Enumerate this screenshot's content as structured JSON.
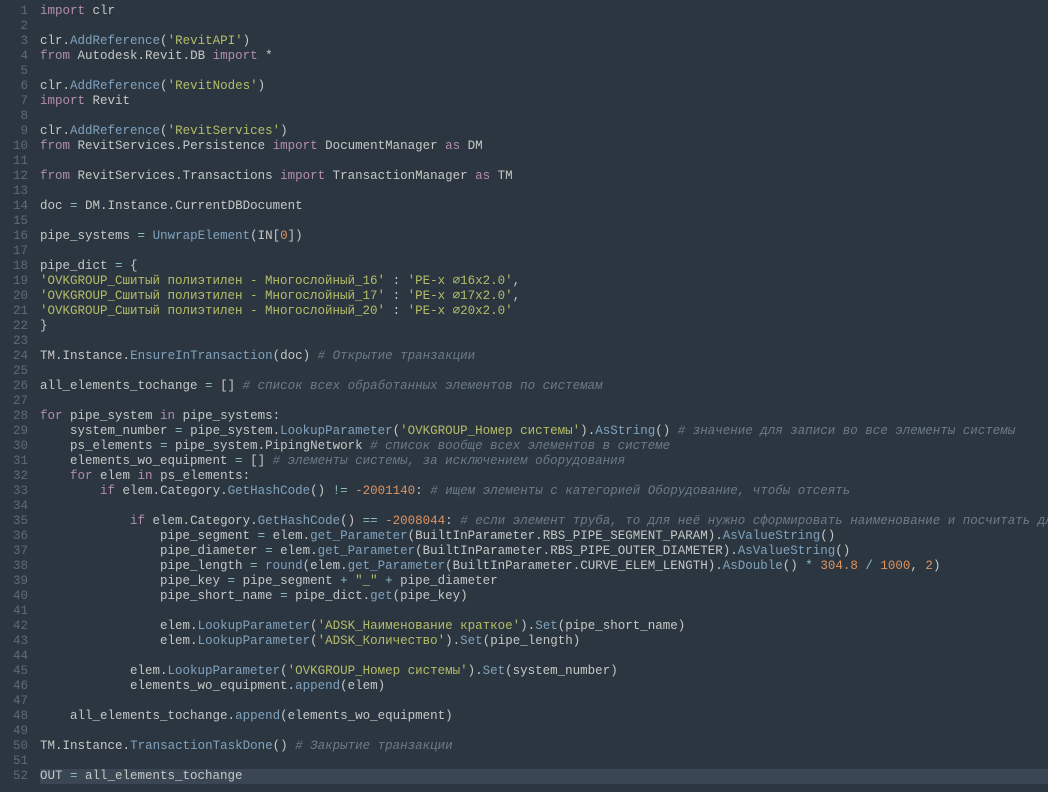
{
  "code_lines": [
    {
      "n": 1,
      "tokens": [
        [
          "kw",
          "import"
        ],
        [
          "id",
          " clr"
        ]
      ]
    },
    {
      "n": 2,
      "tokens": []
    },
    {
      "n": 3,
      "tokens": [
        [
          "id",
          "clr"
        ],
        [
          "op",
          "."
        ],
        [
          "fn",
          "AddReference"
        ],
        [
          "op",
          "("
        ],
        [
          "str",
          "'RevitAPI'"
        ],
        [
          "op",
          ")"
        ]
      ]
    },
    {
      "n": 4,
      "tokens": [
        [
          "kw",
          "from"
        ],
        [
          "id",
          " Autodesk"
        ],
        [
          "op",
          "."
        ],
        [
          "id",
          "Revit"
        ],
        [
          "op",
          "."
        ],
        [
          "id",
          "DB "
        ],
        [
          "kw",
          "import"
        ],
        [
          "id",
          " "
        ],
        [
          "op",
          "*"
        ]
      ]
    },
    {
      "n": 5,
      "tokens": []
    },
    {
      "n": 6,
      "tokens": [
        [
          "id",
          "clr"
        ],
        [
          "op",
          "."
        ],
        [
          "fn",
          "AddReference"
        ],
        [
          "op",
          "("
        ],
        [
          "str",
          "'RevitNodes'"
        ],
        [
          "op",
          ")"
        ]
      ]
    },
    {
      "n": 7,
      "tokens": [
        [
          "kw",
          "import"
        ],
        [
          "id",
          " Revit"
        ]
      ]
    },
    {
      "n": 8,
      "tokens": []
    },
    {
      "n": 9,
      "tokens": [
        [
          "id",
          "clr"
        ],
        [
          "op",
          "."
        ],
        [
          "fn",
          "AddReference"
        ],
        [
          "op",
          "("
        ],
        [
          "str",
          "'RevitServices'"
        ],
        [
          "op",
          ")"
        ]
      ]
    },
    {
      "n": 10,
      "tokens": [
        [
          "kw",
          "from"
        ],
        [
          "id",
          " RevitServices"
        ],
        [
          "op",
          "."
        ],
        [
          "id",
          "Persistence "
        ],
        [
          "kw",
          "import"
        ],
        [
          "id",
          " DocumentManager "
        ],
        [
          "kw",
          "as"
        ],
        [
          "id",
          " DM"
        ]
      ]
    },
    {
      "n": 11,
      "tokens": []
    },
    {
      "n": 12,
      "tokens": [
        [
          "kw",
          "from"
        ],
        [
          "id",
          " RevitServices"
        ],
        [
          "op",
          "."
        ],
        [
          "id",
          "Transactions "
        ],
        [
          "kw",
          "import"
        ],
        [
          "id",
          " TransactionManager "
        ],
        [
          "kw",
          "as"
        ],
        [
          "id",
          " TM"
        ]
      ]
    },
    {
      "n": 13,
      "tokens": []
    },
    {
      "n": 14,
      "tokens": [
        [
          "id",
          "doc "
        ],
        [
          "opcol",
          "="
        ],
        [
          "id",
          " DM"
        ],
        [
          "op",
          "."
        ],
        [
          "id",
          "Instance"
        ],
        [
          "op",
          "."
        ],
        [
          "id",
          "CurrentDBDocument"
        ]
      ]
    },
    {
      "n": 15,
      "tokens": []
    },
    {
      "n": 16,
      "tokens": [
        [
          "id",
          "pipe_systems "
        ],
        [
          "opcol",
          "="
        ],
        [
          "id",
          " "
        ],
        [
          "fn",
          "UnwrapElement"
        ],
        [
          "op",
          "(IN["
        ],
        [
          "num",
          "0"
        ],
        [
          "op",
          "])"
        ]
      ]
    },
    {
      "n": 17,
      "tokens": []
    },
    {
      "n": 18,
      "tokens": [
        [
          "id",
          "pipe_dict "
        ],
        [
          "opcol",
          "="
        ],
        [
          "id",
          " "
        ],
        [
          "op",
          "{"
        ]
      ]
    },
    {
      "n": 19,
      "tokens": [
        [
          "str",
          "'OVKGROUP_Сшитый полиэтилен - Многослойный_16'"
        ],
        [
          "id",
          " "
        ],
        [
          "op",
          ":"
        ],
        [
          "id",
          " "
        ],
        [
          "str",
          "'PE-x ⌀16x2.0'"
        ],
        [
          "op",
          ","
        ]
      ]
    },
    {
      "n": 20,
      "tokens": [
        [
          "str",
          "'OVKGROUP_Сшитый полиэтилен - Многослойный_17'"
        ],
        [
          "id",
          " "
        ],
        [
          "op",
          ":"
        ],
        [
          "id",
          " "
        ],
        [
          "str",
          "'PE-x ⌀17x2.0'"
        ],
        [
          "op",
          ","
        ]
      ]
    },
    {
      "n": 21,
      "tokens": [
        [
          "str",
          "'OVKGROUP_Сшитый полиэтилен - Многослойный_20'"
        ],
        [
          "id",
          " "
        ],
        [
          "op",
          ":"
        ],
        [
          "id",
          " "
        ],
        [
          "str",
          "'PE-x ⌀20x2.0'"
        ]
      ]
    },
    {
      "n": 22,
      "tokens": [
        [
          "op",
          "}"
        ]
      ]
    },
    {
      "n": 23,
      "tokens": []
    },
    {
      "n": 24,
      "tokens": [
        [
          "id",
          "TM"
        ],
        [
          "op",
          "."
        ],
        [
          "id",
          "Instance"
        ],
        [
          "op",
          "."
        ],
        [
          "fn",
          "EnsureInTransaction"
        ],
        [
          "op",
          "(doc) "
        ],
        [
          "com",
          "# Открытие транзакции"
        ]
      ]
    },
    {
      "n": 25,
      "tokens": []
    },
    {
      "n": 26,
      "tokens": [
        [
          "id",
          "all_elements_tochange "
        ],
        [
          "opcol",
          "="
        ],
        [
          "id",
          " "
        ],
        [
          "op",
          "[] "
        ],
        [
          "com",
          "# список всех обработанных элементов по системам"
        ]
      ]
    },
    {
      "n": 27,
      "tokens": []
    },
    {
      "n": 28,
      "tokens": [
        [
          "kw",
          "for"
        ],
        [
          "id",
          " pipe_system "
        ],
        [
          "kw",
          "in"
        ],
        [
          "id",
          " pipe_systems"
        ],
        [
          "op",
          ":"
        ]
      ]
    },
    {
      "n": 29,
      "indent": 1,
      "tokens": [
        [
          "id",
          "system_number "
        ],
        [
          "opcol",
          "="
        ],
        [
          "id",
          " pipe_system"
        ],
        [
          "op",
          "."
        ],
        [
          "fn",
          "LookupParameter"
        ],
        [
          "op",
          "("
        ],
        [
          "str",
          "'OVKGROUP_Номер системы'"
        ],
        [
          "op",
          ")"
        ],
        [
          "op",
          "."
        ],
        [
          "fn",
          "AsString"
        ],
        [
          "op",
          "() "
        ],
        [
          "com",
          "# значение для записи во все элементы системы"
        ]
      ]
    },
    {
      "n": 30,
      "indent": 1,
      "tokens": [
        [
          "id",
          "ps_elements "
        ],
        [
          "opcol",
          "="
        ],
        [
          "id",
          " pipe_system"
        ],
        [
          "op",
          "."
        ],
        [
          "id",
          "PipingNetwork "
        ],
        [
          "com",
          "# список вообще всех элементов в системе"
        ]
      ]
    },
    {
      "n": 31,
      "indent": 1,
      "tokens": [
        [
          "id",
          "elements_wo_equipment "
        ],
        [
          "opcol",
          "="
        ],
        [
          "id",
          " "
        ],
        [
          "op",
          "[] "
        ],
        [
          "com",
          "# элементы системы, за исключением оборудования"
        ]
      ]
    },
    {
      "n": 32,
      "indent": 1,
      "tokens": [
        [
          "kw",
          "for"
        ],
        [
          "id",
          " elem "
        ],
        [
          "kw",
          "in"
        ],
        [
          "id",
          " ps_elements"
        ],
        [
          "op",
          ":"
        ]
      ]
    },
    {
      "n": 33,
      "indent": 2,
      "tokens": [
        [
          "kw",
          "if"
        ],
        [
          "id",
          " elem"
        ],
        [
          "op",
          "."
        ],
        [
          "id",
          "Category"
        ],
        [
          "op",
          "."
        ],
        [
          "fn",
          "GetHashCode"
        ],
        [
          "op",
          "() "
        ],
        [
          "opcol",
          "!="
        ],
        [
          "id",
          " "
        ],
        [
          "num",
          "-2001140"
        ],
        [
          "op",
          ":"
        ],
        [
          "id",
          " "
        ],
        [
          "com",
          "# ищем элементы с категорией Оборудование, чтобы отсеять"
        ]
      ]
    },
    {
      "n": 34,
      "tokens": []
    },
    {
      "n": 35,
      "indent": 3,
      "tokens": [
        [
          "kw",
          "if"
        ],
        [
          "id",
          " elem"
        ],
        [
          "op",
          "."
        ],
        [
          "id",
          "Category"
        ],
        [
          "op",
          "."
        ],
        [
          "fn",
          "GetHashCode"
        ],
        [
          "op",
          "() "
        ],
        [
          "opcol",
          "=="
        ],
        [
          "id",
          " "
        ],
        [
          "num",
          "-2008044"
        ],
        [
          "op",
          ":"
        ],
        [
          "id",
          " "
        ],
        [
          "com",
          "# если элемент труба, то для неё нужно сформировать наименование и посчитать длину"
        ]
      ]
    },
    {
      "n": 36,
      "indent": 4,
      "tokens": [
        [
          "id",
          "pipe_segment "
        ],
        [
          "opcol",
          "="
        ],
        [
          "id",
          " elem"
        ],
        [
          "op",
          "."
        ],
        [
          "fn",
          "get_Parameter"
        ],
        [
          "op",
          "(BuiltInParameter"
        ],
        [
          "op",
          "."
        ],
        [
          "id",
          "RBS_PIPE_SEGMENT_PARAM"
        ],
        [
          "op",
          ")"
        ],
        [
          "op",
          "."
        ],
        [
          "fn",
          "AsValueString"
        ],
        [
          "op",
          "()"
        ]
      ]
    },
    {
      "n": 37,
      "indent": 4,
      "tokens": [
        [
          "id",
          "pipe_diameter "
        ],
        [
          "opcol",
          "="
        ],
        [
          "id",
          " elem"
        ],
        [
          "op",
          "."
        ],
        [
          "fn",
          "get_Parameter"
        ],
        [
          "op",
          "(BuiltInParameter"
        ],
        [
          "op",
          "."
        ],
        [
          "id",
          "RBS_PIPE_OUTER_DIAMETER"
        ],
        [
          "op",
          ")"
        ],
        [
          "op",
          "."
        ],
        [
          "fn",
          "AsValueString"
        ],
        [
          "op",
          "()"
        ]
      ]
    },
    {
      "n": 38,
      "indent": 4,
      "tokens": [
        [
          "id",
          "pipe_length "
        ],
        [
          "opcol",
          "="
        ],
        [
          "id",
          " "
        ],
        [
          "builtin",
          "round"
        ],
        [
          "op",
          "(elem"
        ],
        [
          "op",
          "."
        ],
        [
          "fn",
          "get_Parameter"
        ],
        [
          "op",
          "(BuiltInParameter"
        ],
        [
          "op",
          "."
        ],
        [
          "id",
          "CURVE_ELEM_LENGTH"
        ],
        [
          "op",
          ")"
        ],
        [
          "op",
          "."
        ],
        [
          "fn",
          "AsDouble"
        ],
        [
          "op",
          "() "
        ],
        [
          "opcol",
          "*"
        ],
        [
          "id",
          " "
        ],
        [
          "num",
          "304.8"
        ],
        [
          "id",
          " "
        ],
        [
          "opcol",
          "/"
        ],
        [
          "id",
          " "
        ],
        [
          "num",
          "1000"
        ],
        [
          "op",
          ", "
        ],
        [
          "num",
          "2"
        ],
        [
          "op",
          ")"
        ]
      ]
    },
    {
      "n": 39,
      "indent": 4,
      "tokens": [
        [
          "id",
          "pipe_key "
        ],
        [
          "opcol",
          "="
        ],
        [
          "id",
          " pipe_segment "
        ],
        [
          "opcol",
          "+"
        ],
        [
          "id",
          " "
        ],
        [
          "str",
          "\"_\""
        ],
        [
          "id",
          " "
        ],
        [
          "opcol",
          "+"
        ],
        [
          "id",
          " pipe_diameter"
        ]
      ]
    },
    {
      "n": 40,
      "indent": 4,
      "tokens": [
        [
          "id",
          "pipe_short_name "
        ],
        [
          "opcol",
          "="
        ],
        [
          "id",
          " pipe_dict"
        ],
        [
          "op",
          "."
        ],
        [
          "fn",
          "get"
        ],
        [
          "op",
          "(pipe_key)"
        ]
      ]
    },
    {
      "n": 41,
      "tokens": []
    },
    {
      "n": 42,
      "indent": 4,
      "tokens": [
        [
          "id",
          "elem"
        ],
        [
          "op",
          "."
        ],
        [
          "fn",
          "LookupParameter"
        ],
        [
          "op",
          "("
        ],
        [
          "str",
          "'ADSK_Наименование краткое'"
        ],
        [
          "op",
          ")"
        ],
        [
          "op",
          "."
        ],
        [
          "fn",
          "Set"
        ],
        [
          "op",
          "(pipe_short_name)"
        ]
      ]
    },
    {
      "n": 43,
      "indent": 4,
      "tokens": [
        [
          "id",
          "elem"
        ],
        [
          "op",
          "."
        ],
        [
          "fn",
          "LookupParameter"
        ],
        [
          "op",
          "("
        ],
        [
          "str",
          "'ADSK_Количество'"
        ],
        [
          "op",
          ")"
        ],
        [
          "op",
          "."
        ],
        [
          "fn",
          "Set"
        ],
        [
          "op",
          "(pipe_length)"
        ]
      ]
    },
    {
      "n": 44,
      "tokens": []
    },
    {
      "n": 45,
      "indent": 3,
      "tokens": [
        [
          "id",
          "elem"
        ],
        [
          "op",
          "."
        ],
        [
          "fn",
          "LookupParameter"
        ],
        [
          "op",
          "("
        ],
        [
          "str",
          "'OVKGROUP_Номер системы'"
        ],
        [
          "op",
          ")"
        ],
        [
          "op",
          "."
        ],
        [
          "fn",
          "Set"
        ],
        [
          "op",
          "(system_number)"
        ]
      ]
    },
    {
      "n": 46,
      "indent": 3,
      "tokens": [
        [
          "id",
          "elements_wo_equipment"
        ],
        [
          "op",
          "."
        ],
        [
          "fn",
          "append"
        ],
        [
          "op",
          "(elem)"
        ]
      ]
    },
    {
      "n": 47,
      "tokens": []
    },
    {
      "n": 48,
      "indent": 1,
      "tokens": [
        [
          "id",
          "all_elements_tochange"
        ],
        [
          "op",
          "."
        ],
        [
          "fn",
          "append"
        ],
        [
          "op",
          "(elements_wo_equipment)"
        ]
      ]
    },
    {
      "n": 49,
      "tokens": []
    },
    {
      "n": 50,
      "tokens": [
        [
          "id",
          "TM"
        ],
        [
          "op",
          "."
        ],
        [
          "id",
          "Instance"
        ],
        [
          "op",
          "."
        ],
        [
          "fn",
          "TransactionTaskDone"
        ],
        [
          "op",
          "() "
        ],
        [
          "com",
          "# Закрытие транзакции"
        ]
      ]
    },
    {
      "n": 51,
      "tokens": []
    },
    {
      "n": 52,
      "current": true,
      "tokens": [
        [
          "id",
          "OUT "
        ],
        [
          "opcol",
          "="
        ],
        [
          "id",
          " all_elements_tochange"
        ]
      ]
    }
  ],
  "indent_unit": "    "
}
